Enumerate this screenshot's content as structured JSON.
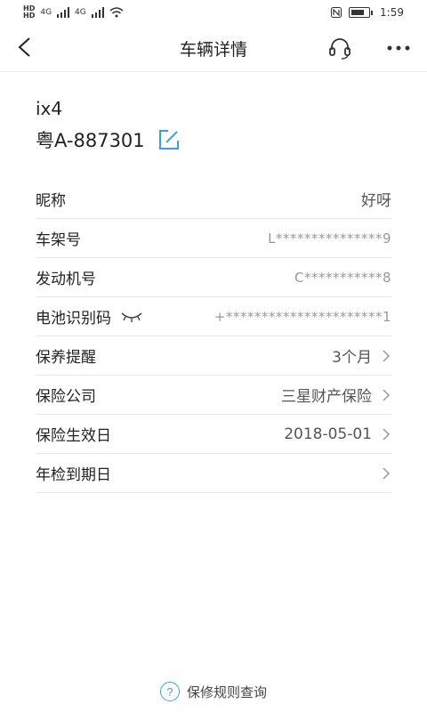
{
  "status_bar": {
    "hd1": "HD",
    "hd2": "HD",
    "net1": "4G",
    "net2": "4G",
    "time": "1:59",
    "icons": [
      "hd-icon",
      "signal-icon",
      "wifi-icon",
      "nfc-icon",
      "battery-icon"
    ]
  },
  "header": {
    "title": "车辆详情",
    "icons": [
      "back-icon",
      "headset-icon",
      "more-icon"
    ]
  },
  "vehicle": {
    "model": "ix4",
    "plate": "粤A-887301"
  },
  "details": [
    {
      "label": "昵称",
      "value": "好呀"
    },
    {
      "label": "车架号",
      "value": "L***************9"
    },
    {
      "label": "发动机号",
      "value": "C***********8"
    },
    {
      "label": "电池识别码",
      "value": "+**********************1"
    },
    {
      "label": "保养提醒",
      "value": "3个月"
    },
    {
      "label": "保险公司",
      "value": "三星财产保险"
    },
    {
      "label": "保险生效日",
      "value": "2018-05-01"
    },
    {
      "label": "年检到期日",
      "value": ""
    }
  ],
  "footer": {
    "link_label": "保修规则查询"
  },
  "colors": {
    "accent": "#3aa0e6",
    "divider": "#e9e9e9",
    "masked_text": "#999999"
  }
}
